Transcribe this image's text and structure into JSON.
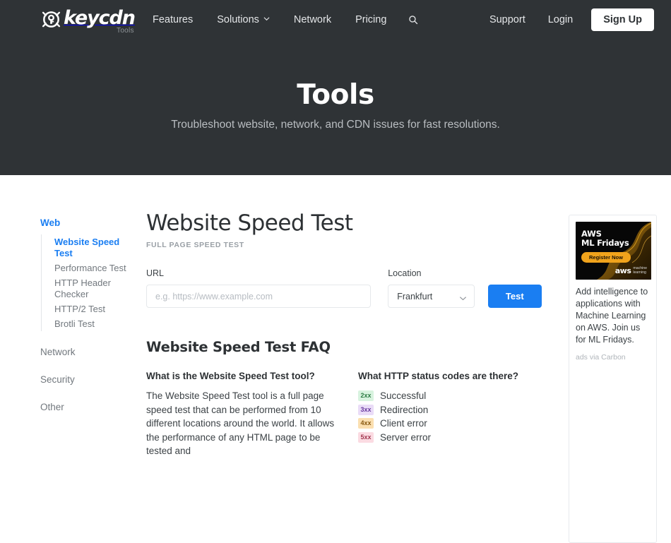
{
  "navbar": {
    "logo": {
      "word": "keycdn",
      "sub": "Tools",
      "icon": "keycdn-key-globe-icon"
    },
    "center_links": [
      {
        "label": "Features",
        "has_caret": false
      },
      {
        "label": "Solutions",
        "has_caret": true
      },
      {
        "label": "Network",
        "has_caret": false
      },
      {
        "label": "Pricing",
        "has_caret": false
      }
    ],
    "search_icon": "search-icon",
    "right_links": [
      {
        "label": "Support"
      },
      {
        "label": "Login"
      }
    ],
    "signup_label": "Sign Up"
  },
  "hero": {
    "title": "Tools",
    "subtitle": "Troubleshoot website, network, and CDN issues for fast resolutions."
  },
  "sidebar": {
    "group_label": "Web",
    "items": [
      {
        "label": "Website Speed Test",
        "active": true
      },
      {
        "label": "Performance Test",
        "active": false
      },
      {
        "label": "HTTP Header Checker",
        "active": false
      },
      {
        "label": "HTTP/2 Test",
        "active": false
      },
      {
        "label": "Brotli Test",
        "active": false
      }
    ],
    "other_groups": [
      {
        "label": "Network"
      },
      {
        "label": "Security"
      },
      {
        "label": "Other"
      }
    ]
  },
  "main": {
    "title": "Website Speed Test",
    "kicker": "FULL PAGE SPEED TEST",
    "form": {
      "url_label": "URL",
      "url_value": "",
      "url_placeholder": "e.g. https://www.example.com",
      "location_label": "Location",
      "location_value": "Frankfurt",
      "submit_label": "Test"
    },
    "faq": {
      "title": "Website Speed Test FAQ",
      "left": {
        "question": "What is the Website Speed Test tool?",
        "answer": "The Website Speed Test tool is a full page speed test that can be performed from 10 different locations around the world. It allows the performance of any HTML page to be tested and"
      },
      "right": {
        "question": "What HTTP status codes are there?",
        "status_codes": [
          {
            "code": "2xx",
            "label": "Successful",
            "bg": "#d8f3df",
            "fg": "#2e7d45"
          },
          {
            "code": "3xx",
            "label": "Redirection",
            "bg": "#eadcf7",
            "fg": "#6a3ba0"
          },
          {
            "code": "4xx",
            "label": "Client error",
            "bg": "#fbdfb0",
            "fg": "#8a5a12"
          },
          {
            "code": "5xx",
            "label": "Server error",
            "bg": "#fbdbe2",
            "fg": "#a33a52"
          }
        ]
      }
    }
  },
  "ad": {
    "banner_title_line1": "AWS",
    "banner_title_line2": "ML Fridays",
    "banner_cta": "Register Now",
    "banner_logo_aws": "aws",
    "banner_logo_ml_line1": "machine",
    "banner_logo_ml_line2": "learning",
    "text": "Add intelligence to applications with Machine Learning on AWS. Join us for ML Fridays.",
    "via": "ads via Carbon"
  },
  "colors": {
    "dark_band": "#2f3336",
    "accent_blue": "#1a7ef2",
    "ad_orange": "#f0a31c"
  }
}
